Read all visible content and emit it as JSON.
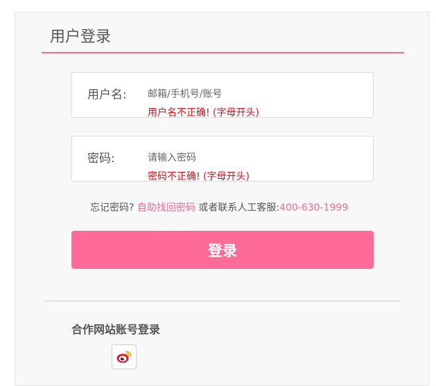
{
  "panel": {
    "title": "用户登录"
  },
  "username": {
    "label": "用户名:",
    "placeholder": "邮箱/手机号/账号",
    "value": "",
    "error": "用户名不正确! (字母开头)"
  },
  "password": {
    "label": "密码:",
    "placeholder": "请输入密码",
    "value": "",
    "error": "密码不正确! (字母开头)"
  },
  "forgot": {
    "prefix": "忘记密码?",
    "self_service_link": "自助找回密码",
    "middle": "或者联系人工客服:",
    "phone": "400-630-1999"
  },
  "login_button": "登录",
  "partner": {
    "title": "合作网站账号登录",
    "providers": [
      {
        "icon": "weibo-icon"
      }
    ]
  },
  "colors": {
    "accent": "#f06a96",
    "button": "#ff6b98",
    "error": "#d4121c"
  }
}
